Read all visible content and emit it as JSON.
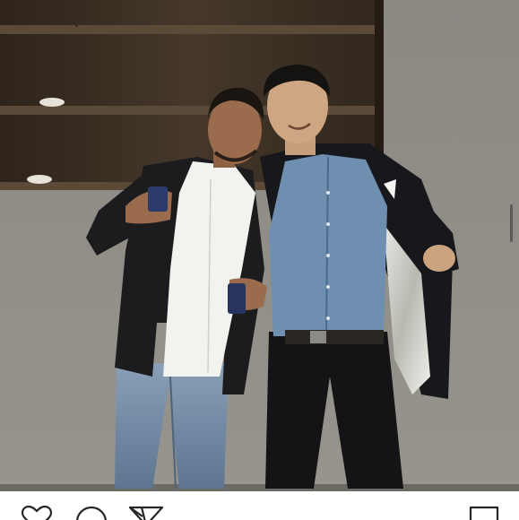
{
  "post": {
    "photo_alt": "",
    "actions": {
      "like": "heart-icon",
      "comment": "comment-bubble-icon",
      "share": "paper-plane-icon",
      "save": "bookmark-icon"
    },
    "colors": {
      "background": "#ffffff",
      "icon": "#262626",
      "wall": "#8f8d86",
      "shelf": "#3b2f22"
    }
  }
}
